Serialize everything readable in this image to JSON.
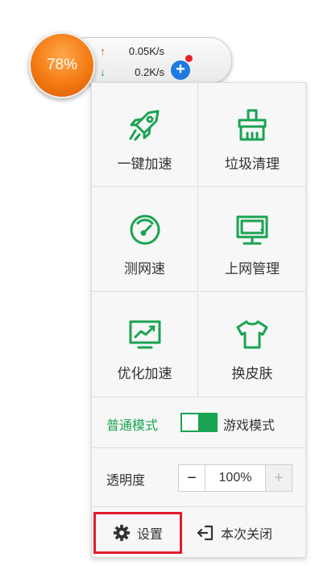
{
  "widget": {
    "percent": "78%",
    "upload": "0.05K/s",
    "download": "0.2K/s",
    "up_icon": "arrow-up-icon",
    "down_icon": "arrow-down-icon",
    "add_icon": "plus-icon"
  },
  "colors": {
    "green": "#1aa352",
    "orange": "#f47a12",
    "red": "#e01c2c",
    "blue": "#1f7be0"
  },
  "tools": [
    {
      "label": "一键加速",
      "icon": "rocket-icon"
    },
    {
      "label": "垃圾清理",
      "icon": "broom-icon"
    },
    {
      "label": "测网速",
      "icon": "speedometer-icon"
    },
    {
      "label": "上网管理",
      "icon": "monitor-icon"
    },
    {
      "label": "优化加速",
      "icon": "chart-monitor-icon"
    },
    {
      "label": "换皮肤",
      "icon": "tshirt-icon"
    }
  ],
  "mode": {
    "normal": "普通模式",
    "game": "游戏模式"
  },
  "opacity": {
    "label": "透明度",
    "minus": "−",
    "value": "100%",
    "plus": "+"
  },
  "footer": {
    "settings": "设置",
    "close": "本次关闭"
  }
}
